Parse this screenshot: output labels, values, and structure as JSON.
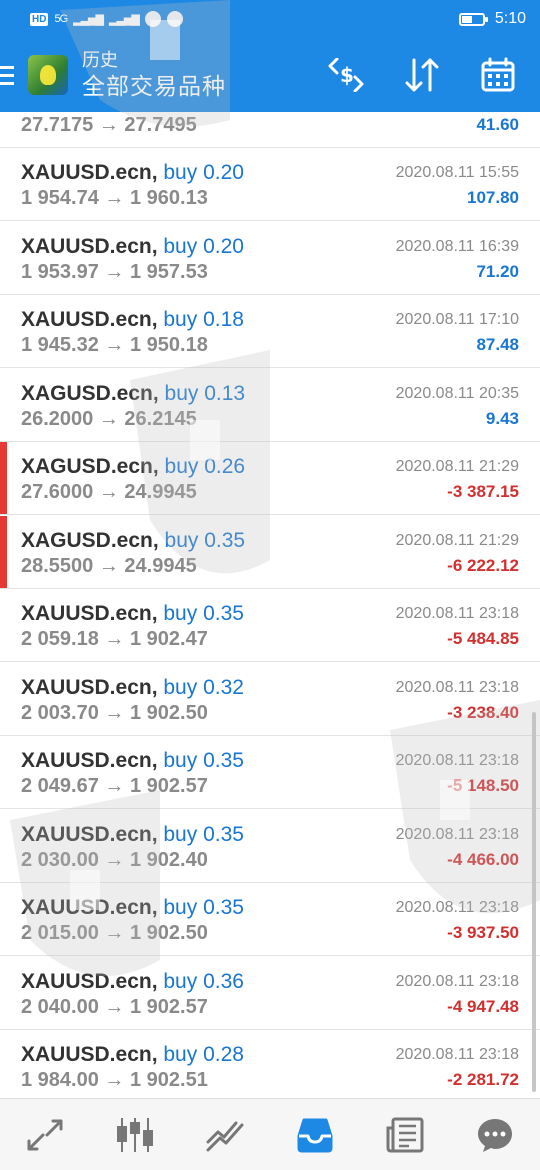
{
  "status_bar": {
    "badge": "HD",
    "network": "5G",
    "time": "5:10"
  },
  "header": {
    "title_small": "历史",
    "title_big": "全部交易品种",
    "icons": [
      "currency-exchange-icon",
      "sort-icon",
      "calendar-icon"
    ]
  },
  "partial_row": {
    "prices": "27.7175 → 27.7495",
    "profit": "41.60"
  },
  "trades": [
    {
      "symbol": "XAUUSD.ecn,",
      "side": "buy 0.20",
      "prices": "1 954.74 → 1 960.13",
      "time": "2020.08.11 15:55",
      "profit": "107.80",
      "sign": "pos",
      "marker": false
    },
    {
      "symbol": "XAUUSD.ecn,",
      "side": "buy 0.20",
      "prices": "1 953.97 → 1 957.53",
      "time": "2020.08.11 16:39",
      "profit": "71.20",
      "sign": "pos",
      "marker": false
    },
    {
      "symbol": "XAUUSD.ecn,",
      "side": "buy 0.18",
      "prices": "1 945.32 → 1 950.18",
      "time": "2020.08.11 17:10",
      "profit": "87.48",
      "sign": "pos",
      "marker": false
    },
    {
      "symbol": "XAGUSD.ecn,",
      "side": "buy 0.13",
      "prices": "26.2000 → 26.2145",
      "time": "2020.08.11 20:35",
      "profit": "9.43",
      "sign": "pos",
      "marker": false
    },
    {
      "symbol": "XAGUSD.ecn,",
      "side": "buy 0.26",
      "prices": "27.6000 → 24.9945",
      "time": "2020.08.11 21:29",
      "profit": "-3 387.15",
      "sign": "neg",
      "marker": true
    },
    {
      "symbol": "XAGUSD.ecn,",
      "side": "buy 0.35",
      "prices": "28.5500 → 24.9945",
      "time": "2020.08.11 21:29",
      "profit": "-6 222.12",
      "sign": "neg",
      "marker": true
    },
    {
      "symbol": "XAUUSD.ecn,",
      "side": "buy 0.35",
      "prices": "2 059.18 → 1 902.47",
      "time": "2020.08.11 23:18",
      "profit": "-5 484.85",
      "sign": "neg",
      "marker": false
    },
    {
      "symbol": "XAUUSD.ecn,",
      "side": "buy 0.32",
      "prices": "2 003.70 → 1 902.50",
      "time": "2020.08.11 23:18",
      "profit": "-3 238.40",
      "sign": "neg",
      "marker": false
    },
    {
      "symbol": "XAUUSD.ecn,",
      "side": "buy 0.35",
      "prices": "2 049.67 → 1 902.57",
      "time": "2020.08.11 23:18",
      "profit": "-5 148.50",
      "sign": "neg",
      "marker": false
    },
    {
      "symbol": "XAUUSD.ecn,",
      "side": "buy 0.35",
      "prices": "2 030.00 → 1 902.40",
      "time": "2020.08.11 23:18",
      "profit": "-4 466.00",
      "sign": "neg",
      "marker": false
    },
    {
      "symbol": "XAUUSD.ecn,",
      "side": "buy 0.35",
      "prices": "2 015.00 → 1 902.50",
      "time": "2020.08.11 23:18",
      "profit": "-3 937.50",
      "sign": "neg",
      "marker": false
    },
    {
      "symbol": "XAUUSD.ecn,",
      "side": "buy 0.36",
      "prices": "2 040.00 → 1 902.57",
      "time": "2020.08.11 23:18",
      "profit": "-4 947.48",
      "sign": "neg",
      "marker": false
    },
    {
      "symbol": "XAUUSD.ecn,",
      "side": "buy 0.28",
      "prices": "1 984.00 → 1 902.51",
      "time": "2020.08.11 23:18",
      "profit": "-2 281.72",
      "sign": "neg",
      "marker": false
    }
  ],
  "bottom_nav": [
    {
      "name": "quotes-icon",
      "active": false
    },
    {
      "name": "chart-icon",
      "active": false
    },
    {
      "name": "trade-icon",
      "active": false
    },
    {
      "name": "history-icon",
      "active": true
    },
    {
      "name": "news-icon",
      "active": false
    },
    {
      "name": "chat-icon",
      "active": false
    }
  ],
  "colors": {
    "accent": "#1e88e5",
    "positive": "#1976d2",
    "negative": "#d32f2f",
    "marker": "#e53935"
  }
}
